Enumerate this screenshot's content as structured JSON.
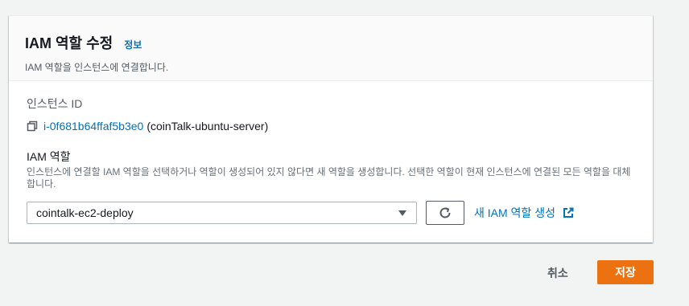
{
  "header": {
    "title": "IAM 역할 수정",
    "info_link": "정보",
    "subtitle": "IAM 역할을 인스턴스에 연결합니다."
  },
  "instance": {
    "label": "인스턴스 ID",
    "id": "i-0f681b64ffaf5b3e0",
    "name": "(coinTalk-ubuntu-server)",
    "icon": "copy-icon"
  },
  "role": {
    "label": "IAM 역할",
    "description": "인스턴스에 연결할 IAM 역할을 선택하거나 역할이 생성되어 있지 않다면 새 역할을 생성합니다. 선택한 역할이 현재 인스턴스에 연결된 모든 역할을 대체합니다.",
    "selected": "cointalk-ec2-deploy",
    "create_link": "새 IAM 역할 생성"
  },
  "footer": {
    "cancel_label": "취소",
    "save_label": "저장"
  },
  "colors": {
    "accent": "#ec7211",
    "link": "#0073bb"
  }
}
